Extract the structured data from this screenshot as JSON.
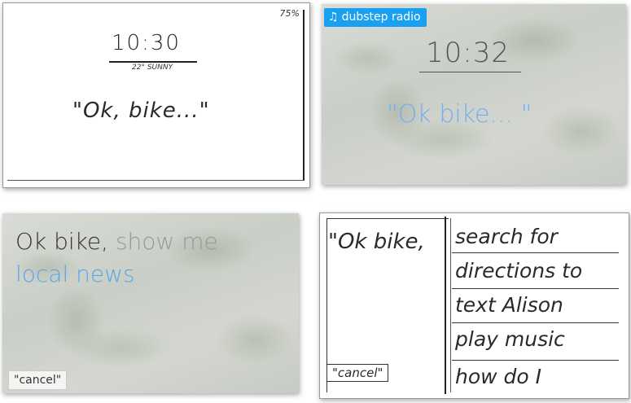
{
  "panel_sketch_home": {
    "battery": "75%",
    "time": "10:30",
    "weather": "22° SUNNY",
    "prompt": "\"Ok, bike...\""
  },
  "panel_digital_home": {
    "badge_icon": "music-note-icon",
    "badge_text": "dubstep radio",
    "time": "10:32",
    "prompt": "\"Ok bike... \"",
    "accent_color": "#1aa0f0"
  },
  "panel_digital_query": {
    "query_start": "Ok bike,",
    "query_rest": " show me",
    "query_line2": "local news",
    "cancel_label": "\"cancel\""
  },
  "panel_sketch_suggestions": {
    "prompt": "\"Ok bike,",
    "options": [
      "search for",
      "directions to",
      "text Alison",
      "play music",
      "how do I"
    ],
    "cancel_label": "\"cancel\""
  }
}
